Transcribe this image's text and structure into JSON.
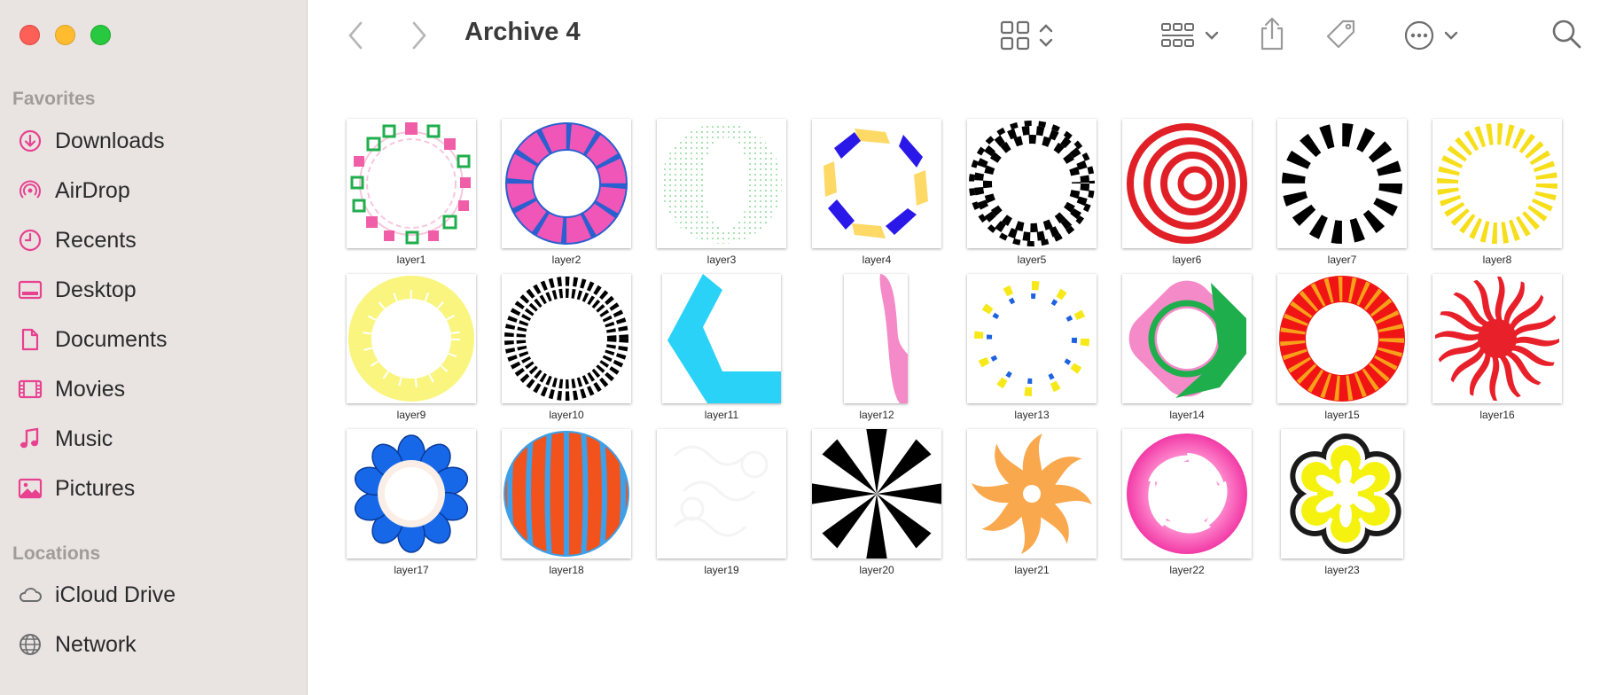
{
  "window": {
    "title": "Archive 4"
  },
  "sidebar": {
    "favorites_title": "Favorites",
    "favorites": [
      {
        "label": "Downloads",
        "icon": "download-icon"
      },
      {
        "label": "AirDrop",
        "icon": "airdrop-icon"
      },
      {
        "label": "Recents",
        "icon": "clock-icon"
      },
      {
        "label": "Desktop",
        "icon": "desktop-icon"
      },
      {
        "label": "Documents",
        "icon": "document-icon"
      },
      {
        "label": "Movies",
        "icon": "film-icon"
      },
      {
        "label": "Music",
        "icon": "music-note-icon"
      },
      {
        "label": "Pictures",
        "icon": "photo-icon"
      }
    ],
    "locations_title": "Locations",
    "locations": [
      {
        "label": "iCloud Drive",
        "icon": "cloud-icon"
      },
      {
        "label": "Network",
        "icon": "globe-icon"
      }
    ]
  },
  "colors": {
    "accent": "#e8418f",
    "sidebar_bg": "#e9e4e2",
    "toolbar_icon": "#6e6e6e"
  },
  "files": [
    {
      "name": "layer1"
    },
    {
      "name": "layer2"
    },
    {
      "name": "layer3"
    },
    {
      "name": "layer4"
    },
    {
      "name": "layer5"
    },
    {
      "name": "layer6"
    },
    {
      "name": "layer7"
    },
    {
      "name": "layer8"
    },
    {
      "name": "layer9"
    },
    {
      "name": "layer10"
    },
    {
      "name": "layer11"
    },
    {
      "name": "layer12"
    },
    {
      "name": "layer13"
    },
    {
      "name": "layer14"
    },
    {
      "name": "layer15"
    },
    {
      "name": "layer16"
    },
    {
      "name": "layer17"
    },
    {
      "name": "layer18"
    },
    {
      "name": "layer19"
    },
    {
      "name": "layer20"
    },
    {
      "name": "layer21"
    },
    {
      "name": "layer22"
    },
    {
      "name": "layer23"
    }
  ]
}
